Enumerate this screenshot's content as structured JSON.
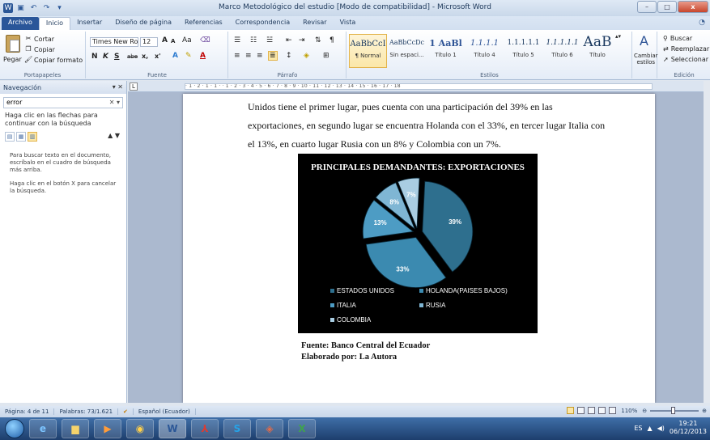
{
  "window": {
    "title": "Marco Metodológico del estudio [Modo de compatibilidad] - Microsoft Word",
    "app_icon": "W",
    "minimize": "–",
    "maximize": "□",
    "close": "x"
  },
  "tabs": [
    "Archivo",
    "Inicio",
    "Insertar",
    "Diseño de página",
    "Referencias",
    "Correspondencia",
    "Revisar",
    "Vista"
  ],
  "ribbon": {
    "clipboard": {
      "label": "Portapapeles",
      "paste": "Pegar",
      "cut": "Cortar",
      "copy": "Copiar",
      "format_painter": "Copiar formato"
    },
    "font": {
      "label": "Fuente",
      "font_name": "Times New Rom",
      "font_size": "12",
      "grow": "A",
      "shrink": "A",
      "case": "Aa",
      "bold": "N",
      "italic": "K",
      "underline": "S",
      "strike": "abe",
      "subscript": "x,",
      "superscript": "x'"
    },
    "paragraph": {
      "label": "Párrafo"
    },
    "styles": {
      "label": "Estilos",
      "items": [
        {
          "sample": "AaBbCcI",
          "name": "¶ Normal"
        },
        {
          "sample": "AaBbCcDc",
          "name": "Sin espaci..."
        },
        {
          "sample": "1 AaBl",
          "name": "Título 1"
        },
        {
          "sample": "1.1.1.1",
          "name": "Título 4"
        },
        {
          "sample": "1.1.1.1.1",
          "name": "Título 5"
        },
        {
          "sample": "1.1.1.1.1",
          "name": "Título 6"
        },
        {
          "sample": "AaB",
          "name": "Título"
        }
      ],
      "change_styles": "Cambiar estilos"
    },
    "editing": {
      "label": "Edición",
      "find": "Buscar",
      "replace": "Reemplazar",
      "select": "Seleccionar"
    }
  },
  "nav": {
    "title": "Navegación",
    "search_value": "error",
    "hint": "Haga clic en las flechas para continuar con la búsqueda",
    "help1": "Para buscar texto en el documento, escríbalo en el cuadro de búsqueda más arriba.",
    "help2": "Haga clic en el botón X para cancelar la búsqueda."
  },
  "ruler_text": "· 1 · 2 · 1 · 1 · · 1 · 2 · 3 · 4 · 5 · 6 · 7 · 8 · 9 · 10 · 11 · 12 · 13 · 14 · 15 · 16 · 17 · 18",
  "document": {
    "lines": [
      "Unidos tiene el primer lugar, pues cuenta con una participación del 39% en las",
      "exportaciones, en segundo lugar se encuentra Holanda con el 33%, en tercer lugar Italia con",
      "el 13%, en cuarto lugar Rusia con un 8%  y Colombia con un 7%."
    ],
    "source": "Fuente: Banco Central del Ecuador",
    "author": "Elaborado por: La Autora"
  },
  "chart_data": {
    "type": "pie",
    "title": "PRINCIPALES DEMANDANTES: EXPORTACIONES",
    "categories": [
      "ESTADOS UNIDOS",
      "HOLANDA(PAISES BAJOS)",
      "ITALIA",
      "RUSIA",
      "COLOMBIA"
    ],
    "values": [
      39,
      33,
      13,
      8,
      7
    ],
    "data_labels": [
      "39%",
      "33%",
      "13%",
      "8%",
      "7%"
    ],
    "colors": [
      "#2e6f8e",
      "#3b8ab0",
      "#4d9cc4",
      "#7fb6d4",
      "#a9cde2"
    ],
    "legend_placement": "bottom"
  },
  "status": {
    "page": "Página: 4 de 11",
    "words": "Palabras: 73/1.621",
    "language": "Español (Ecuador)",
    "zoom": "110%"
  },
  "taskbar": {
    "lang": "ES",
    "time": "19:21",
    "date": "06/12/2013"
  }
}
